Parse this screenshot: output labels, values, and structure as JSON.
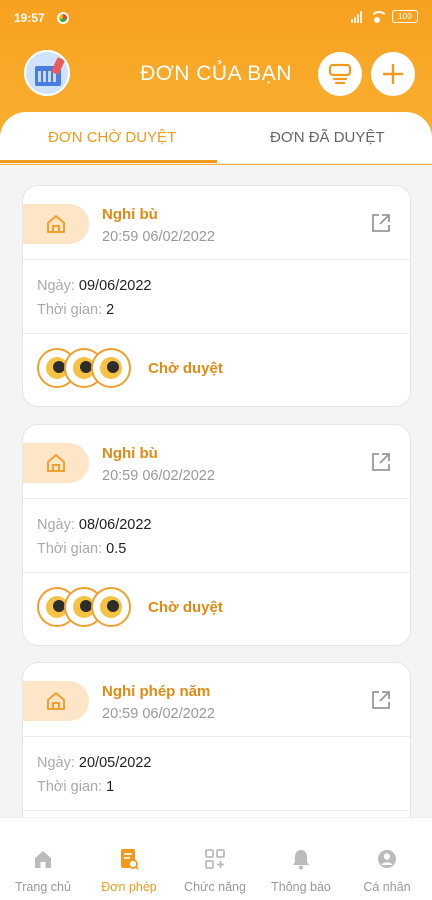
{
  "status_bar": {
    "time": "19:57",
    "battery": "100"
  },
  "header": {
    "title": "ĐƠN CỦA BẠN"
  },
  "tabs": [
    {
      "label": "ĐƠN CHỜ DUYỆT",
      "active": true
    },
    {
      "label": "ĐƠN ĐÃ DUYỆT",
      "active": false
    }
  ],
  "labels": {
    "date": "Ngày: ",
    "duration": "Thời gian: "
  },
  "requests": [
    {
      "type": "Nghỉ bù",
      "created": "20:59 06/02/2022",
      "date": "09/06/2022",
      "duration": "2",
      "status": "Chờ duyệt"
    },
    {
      "type": "Nghỉ bù",
      "created": "20:59 06/02/2022",
      "date": "08/06/2022",
      "duration": "0.5",
      "status": "Chờ duyệt"
    },
    {
      "type": "Nghỉ phép năm",
      "created": "20:59 06/02/2022",
      "date": "20/05/2022",
      "duration": "1",
      "status": ""
    }
  ],
  "bottom_nav": [
    {
      "label": "Trang chủ",
      "icon": "home-icon",
      "active": false
    },
    {
      "label": "Đơn phép",
      "icon": "document-icon",
      "active": true
    },
    {
      "label": "Chức năng",
      "icon": "grid-plus-icon",
      "active": false
    },
    {
      "label": "Thông báo",
      "icon": "bell-icon",
      "active": false
    },
    {
      "label": "Cá nhân",
      "icon": "user-icon",
      "active": false
    }
  ],
  "colors": {
    "accent": "#f29a1b",
    "header": "#f7a11f",
    "chip": "#fde5c8"
  }
}
